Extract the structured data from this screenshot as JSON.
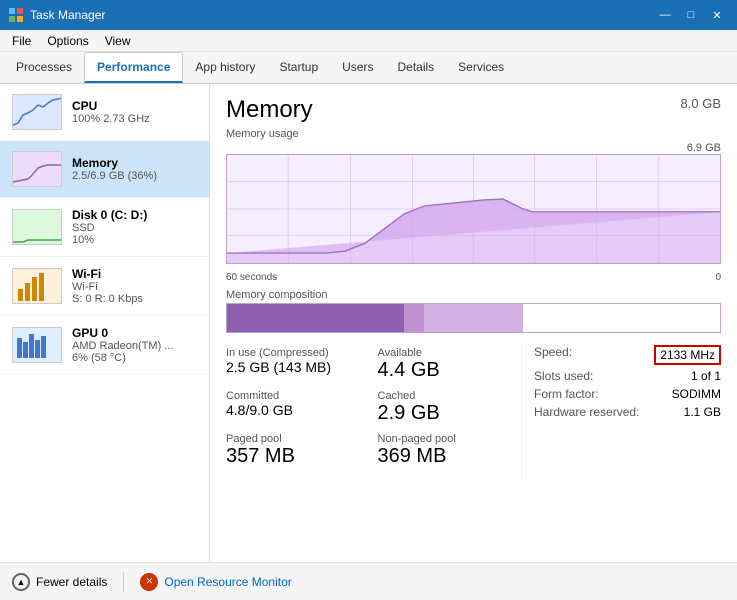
{
  "window": {
    "title": "Task Manager",
    "controls": {
      "minimize": "—",
      "maximize": "□",
      "close": "✕"
    }
  },
  "menu": {
    "items": [
      "File",
      "Options",
      "View"
    ]
  },
  "tabs": [
    {
      "label": "Processes",
      "active": false
    },
    {
      "label": "Performance",
      "active": true
    },
    {
      "label": "App history",
      "active": false
    },
    {
      "label": "Startup",
      "active": false
    },
    {
      "label": "Users",
      "active": false
    },
    {
      "label": "Details",
      "active": false
    },
    {
      "label": "Services",
      "active": false
    }
  ],
  "sidebar": {
    "items": [
      {
        "id": "cpu",
        "title": "CPU",
        "sub1": "100% 2.73 GHz",
        "sub2": "",
        "active": false
      },
      {
        "id": "memory",
        "title": "Memory",
        "sub1": "2.5/6.9 GB (36%)",
        "sub2": "",
        "active": true
      },
      {
        "id": "disk",
        "title": "Disk 0 (C: D:)",
        "sub1": "SSD",
        "sub2": "10%",
        "active": false
      },
      {
        "id": "wifi",
        "title": "Wi-Fi",
        "sub1": "Wi-Fi",
        "sub2": "S: 0 R: 0 Kbps",
        "active": false
      },
      {
        "id": "gpu",
        "title": "GPU 0",
        "sub1": "AMD Radeon(TM) ...",
        "sub2": "6% (58 °C)",
        "active": false
      }
    ]
  },
  "main": {
    "title": "Memory",
    "total": "8.0 GB",
    "chart": {
      "section_label": "Memory usage",
      "right_label": "6.9 GB",
      "time_left": "60 seconds",
      "time_right": "0"
    },
    "composition": {
      "label": "Memory composition"
    },
    "stats": {
      "in_use_label": "In use (Compressed)",
      "in_use_value": "2.5 GB (143 MB)",
      "available_label": "Available",
      "available_value": "4.4 GB",
      "committed_label": "Committed",
      "committed_value": "4.8/9.0 GB",
      "cached_label": "Cached",
      "cached_value": "2.9 GB",
      "paged_label": "Paged pool",
      "paged_value": "357 MB",
      "nonpaged_label": "Non-paged pool",
      "nonpaged_value": "369 MB"
    },
    "specs": {
      "speed_label": "Speed:",
      "speed_value": "2133 MHz",
      "slots_label": "Slots used:",
      "slots_value": "1 of 1",
      "form_label": "Form factor:",
      "form_value": "SODIMM",
      "hw_label": "Hardware reserved:",
      "hw_value": "1.1 GB"
    }
  },
  "footer": {
    "fewer_details": "Fewer details",
    "open_resource": "Open Resource Monitor"
  }
}
